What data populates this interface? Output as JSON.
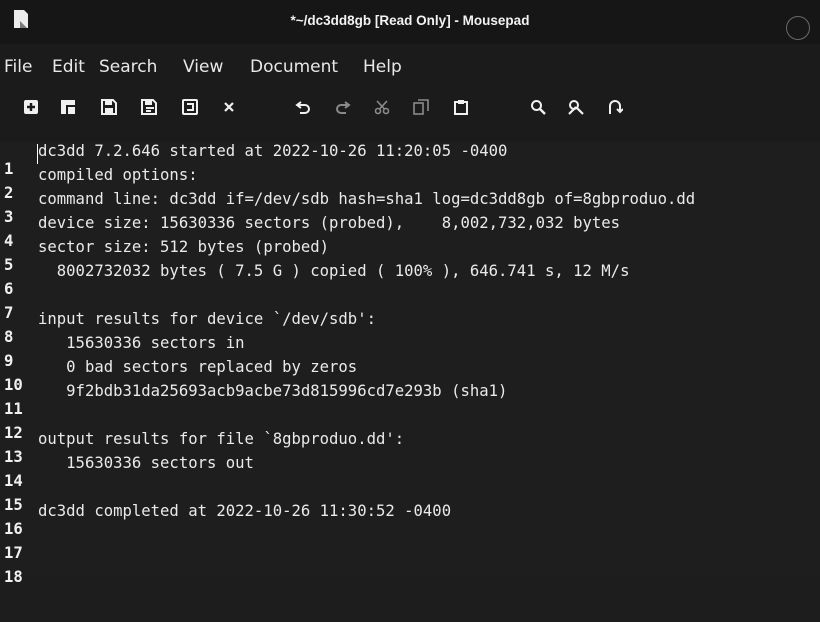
{
  "window": {
    "title": "*~/dc3dd8gb [Read Only] - Mousepad"
  },
  "menu": [
    "File",
    "Edit",
    "Search",
    "View",
    "Document",
    "Help"
  ],
  "toolbar": {
    "buttons": [
      "new-document-icon",
      "new-window-icon",
      "save-icon",
      "save-as-icon",
      "revert-icon",
      "close-icon",
      "undo-icon",
      "redo-icon",
      "cut-icon",
      "copy-icon",
      "paste-icon",
      "find-icon",
      "find-replace-icon",
      "go-to-line-icon"
    ]
  },
  "editor": {
    "lines": [
      {
        "n": "1",
        "text": "dc3dd 7.2.646 started at 2022-10-26 11:20:05 -0400"
      },
      {
        "n": "2",
        "text": "compiled options:"
      },
      {
        "n": "3",
        "text": "command line: dc3dd if=/dev/sdb hash=sha1 log=dc3dd8gb of=8gbproduo.dd"
      },
      {
        "n": "4",
        "text": "device size: 15630336 sectors (probed),    8,002,732,032 bytes"
      },
      {
        "n": "5",
        "text": "sector size: 512 bytes (probed)"
      },
      {
        "n": "6",
        "text": "  8002732032 bytes ( 7.5 G ) copied ( 100% ), 646.741 s, 12 M/s"
      },
      {
        "n": "7",
        "text": ""
      },
      {
        "n": "8",
        "text": "input results for device `/dev/sdb':"
      },
      {
        "n": "9",
        "text": "   15630336 sectors in"
      },
      {
        "n": "10",
        "text": "   0 bad sectors replaced by zeros"
      },
      {
        "n": "11",
        "text": "   9f2bdb31da25693acb9acbe73d815996cd7e293b (sha1)"
      },
      {
        "n": "12",
        "text": ""
      },
      {
        "n": "13",
        "text": "output results for file `8gbproduo.dd':"
      },
      {
        "n": "14",
        "text": "   15630336 sectors out"
      },
      {
        "n": "15",
        "text": ""
      },
      {
        "n": "16",
        "text": "dc3dd completed at 2022-10-26 11:30:52 -0400"
      },
      {
        "n": "17",
        "text": ""
      },
      {
        "n": "18",
        "text": ""
      }
    ]
  }
}
